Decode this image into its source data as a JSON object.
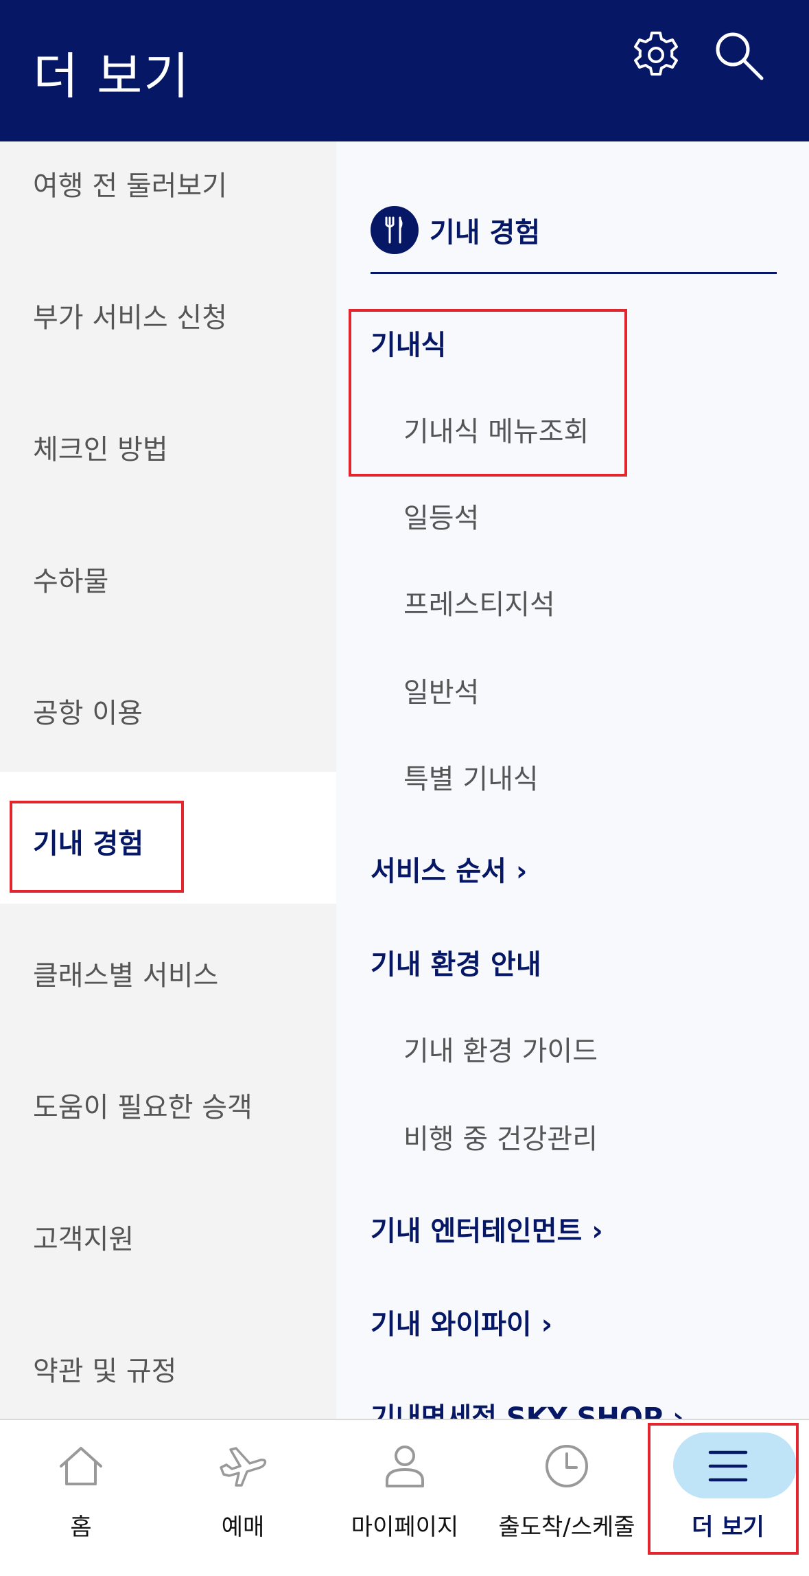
{
  "header": {
    "title": "더 보기",
    "settings_icon": "gear-icon",
    "search_icon": "search-icon"
  },
  "sidebar": {
    "items": [
      {
        "label": "여행 전 둘러보기"
      },
      {
        "label": "부가 서비스 신청"
      },
      {
        "label": "체크인 방법"
      },
      {
        "label": "수하물"
      },
      {
        "label": "공항 이용"
      },
      {
        "label": "기내 경험",
        "active": true
      },
      {
        "label": "클래스별 서비스"
      },
      {
        "label": "도움이 필요한 승객"
      },
      {
        "label": "고객지원"
      },
      {
        "label": "약관 및 규정"
      }
    ]
  },
  "content": {
    "section_icon": "cutlery-icon",
    "section_title": "기내 경험",
    "categories": [
      {
        "label": "기내식",
        "subitems": [
          "기내식 메뉴조회",
          "일등석",
          "프레스티지석",
          "일반석",
          "특별 기내식"
        ]
      },
      {
        "label": "서비스 순서 ›"
      },
      {
        "label": "기내 환경 안내",
        "subitems": [
          "기내 환경 가이드",
          "비행 중 건강관리"
        ]
      },
      {
        "label": "기내 엔터테인먼트 ›"
      },
      {
        "label": "기내 와이파이 ›"
      },
      {
        "label": "기내면세점 SKY SHOP ›"
      }
    ]
  },
  "bottom_nav": {
    "items": [
      {
        "label": "홈",
        "icon": "home-icon"
      },
      {
        "label": "예매",
        "icon": "airplane-icon"
      },
      {
        "label": "마이페이지",
        "icon": "user-icon"
      },
      {
        "label": "출도착/스케줄",
        "icon": "clock-icon"
      },
      {
        "label": "더 보기",
        "icon": "menu-icon",
        "active": true
      }
    ]
  },
  "colors": {
    "navy": "#061766",
    "highlight_red": "#e3262e",
    "active_pill": "#bfe4f7",
    "sidebar_bg": "#f3f3f3"
  }
}
